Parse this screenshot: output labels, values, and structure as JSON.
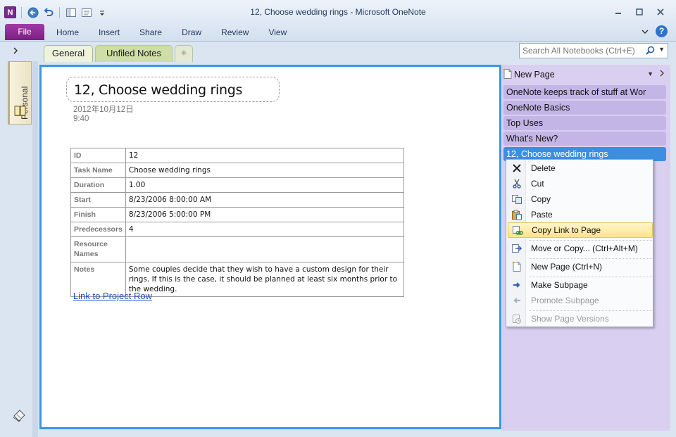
{
  "window": {
    "title": "12, Choose wedding rings  -  Microsoft OneNote",
    "app_logo": "N"
  },
  "ribbon": {
    "file_label": "File",
    "tabs": [
      "Home",
      "Insert",
      "Share",
      "Draw",
      "Review",
      "View"
    ]
  },
  "notebook": {
    "name": "Personal"
  },
  "sections": {
    "tabs": [
      {
        "label": "General",
        "active": true,
        "color": "#edf3dd"
      },
      {
        "label": "Unfiled Notes",
        "active": false,
        "color": "#cfdda6"
      }
    ],
    "new_tab_glyph": "✳"
  },
  "search": {
    "placeholder": "Search All Notebooks (Ctrl+E)"
  },
  "page": {
    "title": "12, Choose wedding rings",
    "date": "2012年10月12日",
    "time": "9:40",
    "table": [
      {
        "key": "ID",
        "value": "12"
      },
      {
        "key": "Task Name",
        "value": "Choose wedding rings"
      },
      {
        "key": "Duration",
        "value": "1.00"
      },
      {
        "key": "Start",
        "value": "8/23/2006 8:00:00 AM"
      },
      {
        "key": "Finish",
        "value": "8/23/2006 5:00:00 PM"
      },
      {
        "key": "Predecessors",
        "value": "4"
      },
      {
        "key": "Resource Names",
        "value": ""
      },
      {
        "key": "Notes",
        "value": "Some couples decide that they wish to have a custom design for their rings. If this is the case, it should be planned at least six months prior to the wedding."
      }
    ],
    "link_text": "Link to Project Row"
  },
  "page_list": {
    "new_page_label": "New Page",
    "items": [
      {
        "label": "OneNote keeps track of stuff at Wor",
        "selected": false
      },
      {
        "label": "OneNote Basics",
        "selected": false
      },
      {
        "label": "Top Uses",
        "selected": false
      },
      {
        "label": "What's New?",
        "selected": false
      },
      {
        "label": "12, Choose wedding rings",
        "selected": true
      }
    ]
  },
  "context_menu": {
    "items": [
      {
        "label": "Delete",
        "icon": "delete-x-icon",
        "enabled": true,
        "highlighted": false
      },
      {
        "label": "Cut",
        "icon": "scissors-icon",
        "enabled": true,
        "highlighted": false
      },
      {
        "label": "Copy",
        "icon": "copy-icon",
        "enabled": true,
        "highlighted": false
      },
      {
        "label": "Paste",
        "icon": "paste-icon",
        "enabled": true,
        "highlighted": false
      },
      {
        "label": "Copy Link to Page",
        "icon": "copy-link-icon",
        "enabled": true,
        "highlighted": true
      },
      {
        "label": "Move or Copy...  (Ctrl+Alt+M)",
        "icon": "move-copy-icon",
        "enabled": true,
        "highlighted": false
      },
      {
        "label": "New Page  (Ctrl+N)",
        "icon": "new-page-icon",
        "enabled": true,
        "highlighted": false
      },
      {
        "label": "Make Subpage",
        "icon": "arrow-right-icon",
        "enabled": true,
        "highlighted": false
      },
      {
        "label": "Promote Subpage",
        "icon": "arrow-left-icon",
        "enabled": false,
        "highlighted": false
      },
      {
        "label": "Show Page Versions",
        "icon": "page-versions-icon",
        "enabled": false,
        "highlighted": false
      }
    ]
  },
  "colors": {
    "accent": "#3d95e5",
    "file_tab": "#8a2a90",
    "page_tab_selected": "#3b8fe1",
    "page_tab": "#c4b5e7",
    "menu_highlight": "#fde48a"
  }
}
